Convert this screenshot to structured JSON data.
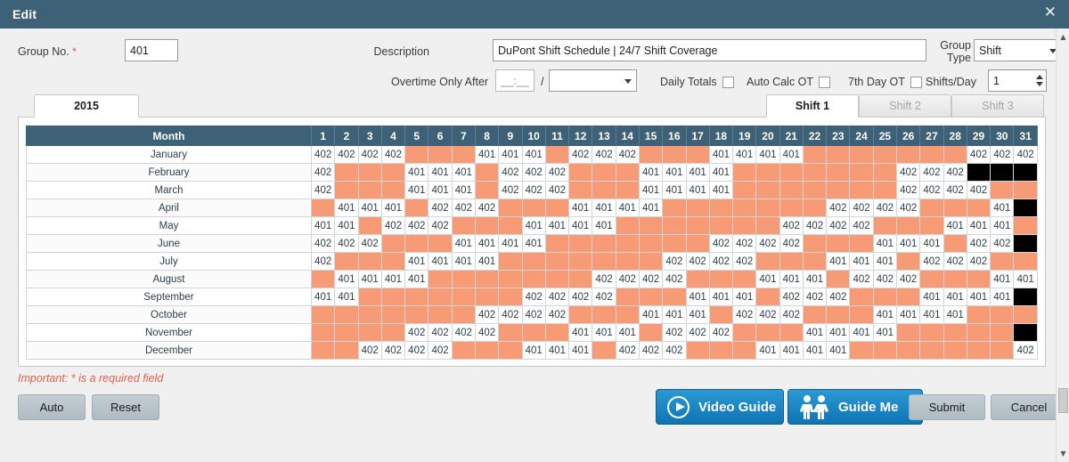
{
  "window": {
    "title": "Edit",
    "close_icon": "close-icon"
  },
  "form": {
    "group_no_label": "Group No.",
    "required_marker": "*",
    "group_no_value": "401",
    "description_label": "Description",
    "description_value": "DuPont Shift Schedule | 24/7 Shift Coverage",
    "group_type_label_line1": "Group",
    "group_type_label_line2": "Type",
    "group_type_value": "Shift",
    "overtime_label": "Overtime Only After",
    "overtime_value": "__:__",
    "overtime_separator": "/",
    "overtime_period_value": "",
    "daily_totals_label": "Daily Totals",
    "auto_calc_ot_label": "Auto Calc OT",
    "seventh_day_ot_label": "7th Day OT",
    "shifts_per_day_label": "Shifts/Day",
    "shifts_per_day_value": "1"
  },
  "tabs": {
    "year": "2015",
    "shifts": [
      {
        "label": "Shift 1",
        "active": true
      },
      {
        "label": "Shift 2",
        "active": false
      },
      {
        "label": "Shift 3",
        "active": false
      }
    ]
  },
  "grid": {
    "month_header": "Month",
    "day_headers": [
      "1",
      "2",
      "3",
      "4",
      "5",
      "6",
      "7",
      "8",
      "9",
      "10",
      "11",
      "12",
      "13",
      "14",
      "15",
      "16",
      "17",
      "18",
      "19",
      "20",
      "21",
      "22",
      "23",
      "24",
      "25",
      "26",
      "27",
      "28",
      "29",
      "30",
      "31"
    ],
    "legend": {
      "on_color": "#ffffff",
      "off_color": "#f79a76",
      "na_color": "#000000"
    },
    "rows": [
      {
        "month": "January",
        "days": [
          "402",
          "402",
          "402",
          "402",
          "",
          "",
          "",
          "401",
          "401",
          "401",
          "",
          "402",
          "402",
          "402",
          "",
          "",
          "",
          "401",
          "401",
          "401",
          "401",
          "",
          "",
          "",
          "",
          "",
          "",
          "",
          "402",
          "402",
          "402"
        ]
      },
      {
        "month": "February",
        "days": [
          "402",
          "",
          "",
          "",
          "401",
          "401",
          "401",
          "",
          "402",
          "402",
          "402",
          "",
          "",
          "",
          "401",
          "401",
          "401",
          "401",
          "",
          "",
          "",
          "",
          "",
          "",
          "",
          "402",
          "402",
          "402",
          null,
          null,
          null
        ]
      },
      {
        "month": "March",
        "days": [
          "402",
          "",
          "",
          "",
          "401",
          "401",
          "401",
          "",
          "402",
          "402",
          "402",
          "",
          "",
          "",
          "401",
          "401",
          "401",
          "401",
          "",
          "",
          "",
          "",
          "",
          "",
          "",
          "402",
          "402",
          "402",
          "402",
          "",
          ""
        ]
      },
      {
        "month": "April",
        "days": [
          "",
          "401",
          "401",
          "401",
          "",
          "402",
          "402",
          "402",
          "",
          "",
          "",
          "401",
          "401",
          "401",
          "401",
          "",
          "",
          "",
          "",
          "",
          "",
          "",
          "402",
          "402",
          "402",
          "402",
          "",
          "",
          "",
          "401",
          null
        ]
      },
      {
        "month": "May",
        "days": [
          "401",
          "401",
          "",
          "402",
          "402",
          "402",
          "",
          "",
          "",
          "401",
          "401",
          "401",
          "401",
          "",
          "",
          "",
          "",
          "",
          "",
          "",
          "402",
          "402",
          "402",
          "402",
          "",
          "",
          "",
          "401",
          "401",
          "401",
          ""
        ]
      },
      {
        "month": "June",
        "days": [
          "402",
          "402",
          "402",
          "",
          "",
          "",
          "401",
          "401",
          "401",
          "401",
          "",
          "",
          "",
          "",
          "",
          "",
          "",
          "402",
          "402",
          "402",
          "402",
          "",
          "",
          "",
          "401",
          "401",
          "401",
          "",
          "402",
          "402",
          null
        ]
      },
      {
        "month": "July",
        "days": [
          "402",
          "",
          "",
          "",
          "401",
          "401",
          "401",
          "401",
          "",
          "",
          "",
          "",
          "",
          "",
          "",
          "402",
          "402",
          "402",
          "402",
          "",
          "",
          "",
          "401",
          "401",
          "401",
          "",
          "402",
          "402",
          "402",
          "",
          ""
        ]
      },
      {
        "month": "August",
        "days": [
          "",
          "401",
          "401",
          "401",
          "401",
          "",
          "",
          "",
          "",
          "",
          "",
          "",
          "402",
          "402",
          "402",
          "402",
          "",
          "",
          "",
          "401",
          "401",
          "401",
          "",
          "402",
          "402",
          "402",
          "",
          "",
          "",
          "401",
          "401"
        ]
      },
      {
        "month": "September",
        "days": [
          "401",
          "401",
          "",
          "",
          "",
          "",
          "",
          "",
          "",
          "402",
          "402",
          "402",
          "402",
          "",
          "",
          "",
          "401",
          "401",
          "401",
          "",
          "402",
          "402",
          "402",
          "",
          "",
          "",
          "401",
          "401",
          "401",
          "401",
          null
        ]
      },
      {
        "month": "October",
        "days": [
          "",
          "",
          "",
          "",
          "",
          "",
          "",
          "402",
          "402",
          "402",
          "402",
          "",
          "",
          "",
          "401",
          "401",
          "401",
          "",
          "402",
          "402",
          "402",
          "",
          "",
          "",
          "401",
          "401",
          "401",
          "401",
          "",
          "",
          ""
        ]
      },
      {
        "month": "November",
        "days": [
          "",
          "",
          "",
          "",
          "402",
          "402",
          "402",
          "402",
          "",
          "",
          "",
          "401",
          "401",
          "401",
          "",
          "402",
          "402",
          "402",
          "",
          "",
          "",
          "401",
          "401",
          "401",
          "401",
          "",
          "",
          "",
          "",
          "",
          null
        ]
      },
      {
        "month": "December",
        "days": [
          "",
          "",
          "402",
          "402",
          "402",
          "402",
          "",
          "",
          "",
          "401",
          "401",
          "401",
          "",
          "402",
          "402",
          "402",
          "",
          "",
          "",
          "401",
          "401",
          "401",
          "401",
          "",
          "",
          "",
          "",
          "",
          "",
          "",
          "402"
        ]
      }
    ]
  },
  "footer": {
    "important_note": "Important: * is a required field",
    "auto_label": "Auto",
    "reset_label": "Reset",
    "video_guide_label": "Video Guide",
    "guide_me_label": "Guide Me",
    "submit_label": "Submit",
    "cancel_label": "Cancel"
  }
}
